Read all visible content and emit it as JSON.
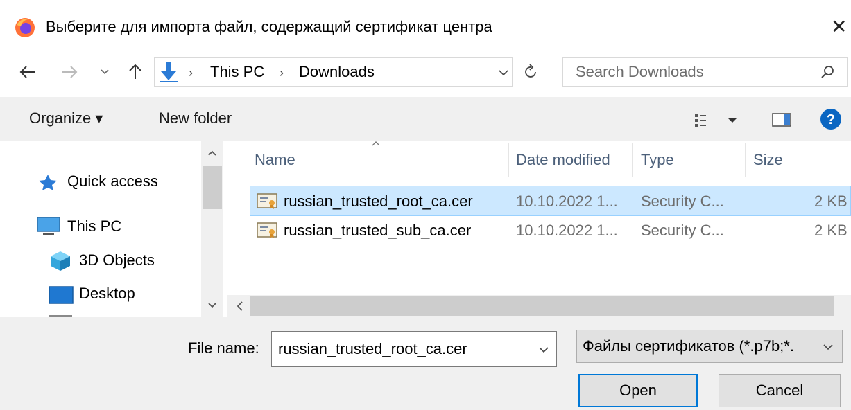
{
  "window": {
    "title": "Выберите для импорта файл, содержащий сертификат центра",
    "app_icon": "firefox-icon",
    "close_glyph": "✕"
  },
  "address": {
    "crumbs": [
      "This PC",
      "Downloads"
    ],
    "location_icon": "download-arrow-icon",
    "search_placeholder": "Search Downloads"
  },
  "toolbar": {
    "organize_label": "Organize ▾",
    "new_folder_label": "New folder"
  },
  "nav": {
    "items": [
      {
        "label": "Quick access",
        "icon": "star-icon"
      },
      {
        "label": "This PC",
        "icon": "computer-icon"
      },
      {
        "label": "3D Objects",
        "icon": "cube-icon"
      },
      {
        "label": "Desktop",
        "icon": "desktop-icon"
      }
    ]
  },
  "list": {
    "columns": [
      "Name",
      "Date modified",
      "Type",
      "Size"
    ],
    "rows": [
      {
        "name": "russian_trusted_root_ca.cer",
        "date": "10.10.2022 1...",
        "type": "Security C...",
        "size": "2 KB",
        "selected": true
      },
      {
        "name": "russian_trusted_sub_ca.cer",
        "date": "10.10.2022 1...",
        "type": "Security C...",
        "size": "2 KB",
        "selected": false
      }
    ]
  },
  "footer": {
    "filename_label": "File name:",
    "filename_value": "russian_trusted_root_ca.cer",
    "filetype_value": "Файлы сертификатов (*.p7b;*.",
    "open_label": "Open",
    "cancel_label": "Cancel"
  },
  "colors": {
    "selection": "#cce8ff",
    "accent": "#0078d7",
    "help": "#0a66c2"
  }
}
